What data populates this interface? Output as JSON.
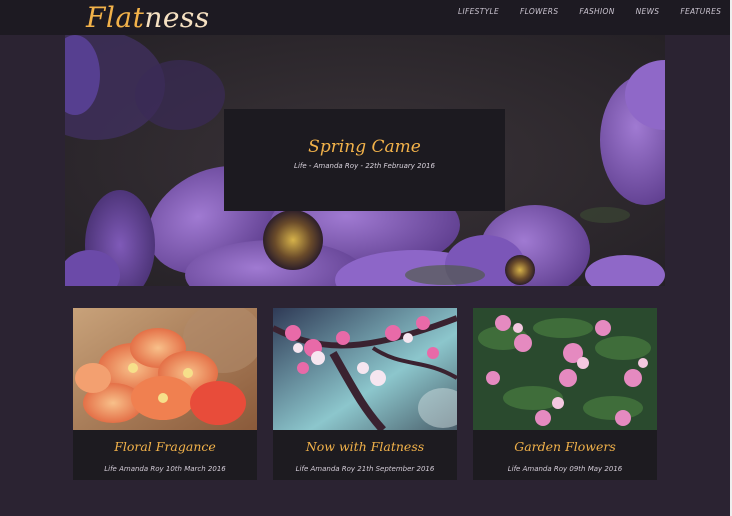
{
  "brand": {
    "part1": "Flat",
    "part2": "ness"
  },
  "nav": [
    "LIFESTYLE",
    "FLOWERS",
    "FASHION",
    "NEWS",
    "FEATURES"
  ],
  "hero": {
    "title": "Spring Came",
    "meta": "Life - Amanda Roy - 22th February 2016"
  },
  "cards": [
    {
      "title": "Floral Fragance",
      "meta": "Life Amanda Roy 10th March 2016"
    },
    {
      "title": "Now with Flatness",
      "meta": "Life Amanda Roy 21th September 2016"
    },
    {
      "title": "Garden Flowers",
      "meta": "Life Amanda Roy 09th May 2016"
    }
  ]
}
